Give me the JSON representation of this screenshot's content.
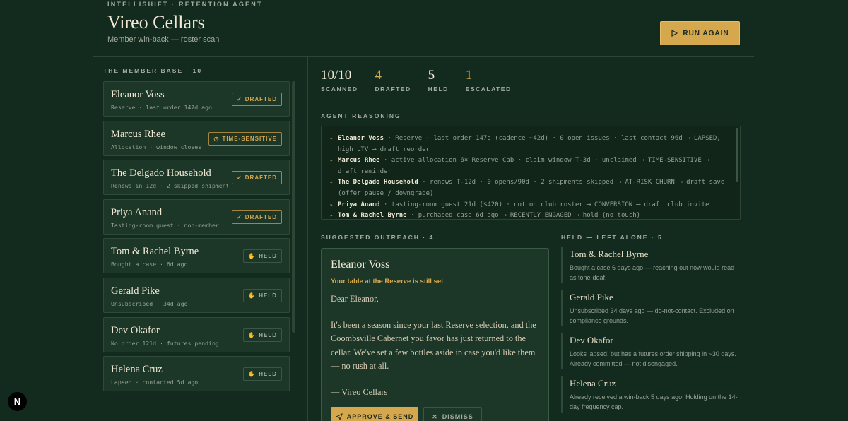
{
  "header": {
    "eyebrow": "INTELLISHIFT · RETENTION AGENT",
    "title": "Vireo Cellars",
    "subtitle": "Member win-back — roster scan",
    "run_again": "RUN AGAIN"
  },
  "member_base": {
    "label": "THE MEMBER BASE · 10",
    "members": [
      {
        "name": "Eleanor Voss",
        "meta": "Reserve · last order 147d ago",
        "badge": "DRAFTED",
        "badge_icon": "✓"
      },
      {
        "name": "Marcus Rhee",
        "meta": "Allocation · window closes 3d",
        "badge": "TIME-SENSITIVE",
        "badge_icon": "◷"
      },
      {
        "name": "The Delgado Household",
        "meta": "Renews in 12d · 2 skipped shipments",
        "badge": "DRAFTED",
        "badge_icon": "✓"
      },
      {
        "name": "Priya Anand",
        "meta": "Tasting-room guest · non-member",
        "badge": "DRAFTED",
        "badge_icon": "✓"
      },
      {
        "name": "Tom & Rachel Byrne",
        "meta": "Bought a case · 6d ago",
        "badge": "HELD",
        "badge_icon": "✋"
      },
      {
        "name": "Gerald Pike",
        "meta": "Unsubscribed · 34d ago",
        "badge": "HELD",
        "badge_icon": "✋"
      },
      {
        "name": "Dev Okafor",
        "meta": "No order 121d · futures pending",
        "badge": "HELD",
        "badge_icon": "✋"
      },
      {
        "name": "Helena Cruz",
        "meta": "Lapsed · contacted 5d ago",
        "badge": "HELD",
        "badge_icon": "✋"
      }
    ]
  },
  "stats": [
    {
      "value": "10/10",
      "label": "SCANNED"
    },
    {
      "value": "4",
      "label": "DRAFTED"
    },
    {
      "value": "5",
      "label": "HELD"
    },
    {
      "value": "1",
      "label": "ESCALATED"
    }
  ],
  "reasoning": {
    "label": "AGENT REASONING",
    "lines": [
      {
        "name": "Eleanor Voss",
        "text": " · Reserve · last order 147d (cadence ~42d) · 0 open issues · last contact 96d ⟶ LAPSED, high LTV ⟶ draft reorder"
      },
      {
        "name": "Marcus Rhee",
        "text": " · active allocation 6× Reserve Cab · claim window T-3d · unclaimed ⟶ TIME-SENSITIVE ⟶ draft reminder"
      },
      {
        "name": "The Delgado Household",
        "text": " · renews T-12d · 0 opens/90d · 2 shipments skipped ⟶ AT-RISK CHURN ⟶ draft save (offer pause / downgrade)"
      },
      {
        "name": "Priya Anand",
        "text": " · tasting-room guest 21d ($420) · not on club roster ⟶ CONVERSION ⟶ draft club invite"
      },
      {
        "name": "Tom & Rachel Byrne",
        "text": " · purchased case 6d ago ⟶ RECENTLY ENGAGED ⟶ hold (no touch)"
      }
    ]
  },
  "outreach": {
    "label": "SUGGESTED OUTREACH · 4",
    "name": "Eleanor Voss",
    "subject": "Your table at the Reserve is still set",
    "greeting": "Dear Eleanor,",
    "body": "It's been a season since your last Reserve selection, and the Coombsville Cabernet you favor has just returned to the cellar. We've set a few bottles aside in case you'd like them — no rush at all.",
    "signoff": "— Vireo Cellars",
    "approve": "APPROVE & SEND",
    "dismiss": "DISMISS"
  },
  "held": {
    "label": "HELD — LEFT ALONE · 5",
    "items": [
      {
        "name": "Tom & Rachel Byrne",
        "note": "Bought a case 6 days ago — reaching out now would read as tone-deaf."
      },
      {
        "name": "Gerald Pike",
        "note": "Unsubscribed 34 days ago — do-not-contact. Excluded on compliance grounds."
      },
      {
        "name": "Dev Okafor",
        "note": "Looks lapsed, but has a futures order shipping in ~30 days. Already committed — not disengaged."
      },
      {
        "name": "Helena Cruz",
        "note": "Already received a win-back 5 days ago. Holding on the 14-day frequency cap."
      }
    ]
  },
  "corner_badge": "N"
}
